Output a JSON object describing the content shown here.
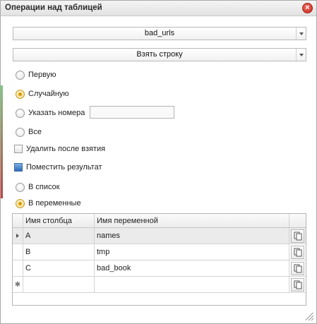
{
  "window": {
    "title": "Операции над таблицей"
  },
  "table_select": {
    "value": "bad_urls"
  },
  "operation_select": {
    "value": "Взять строку"
  },
  "row_options": [
    {
      "label": "Первую",
      "selected": false
    },
    {
      "label": "Случайную",
      "selected": true
    },
    {
      "label": "Указать номера",
      "selected": false,
      "input_value": ""
    },
    {
      "label": "Все",
      "selected": false
    }
  ],
  "delete_after": {
    "label": "Удалить после взятия",
    "checked": false
  },
  "put_result": {
    "label": "Поместить результат",
    "checked": true
  },
  "target_options": [
    {
      "label": "В список",
      "selected": false
    },
    {
      "label": "В переменные",
      "selected": true
    }
  ],
  "grid": {
    "columns": [
      "Имя столбца",
      "Имя переменной"
    ],
    "rows": [
      {
        "column": "A",
        "variable": "names",
        "selected": true
      },
      {
        "column": "B",
        "variable": "tmp",
        "selected": false
      },
      {
        "column": "C",
        "variable": "bad_book",
        "selected": false
      },
      {
        "column": "",
        "variable": "",
        "new_row": true
      }
    ]
  },
  "colors": {
    "accent_radio": "#d79a00",
    "close": "#c6281b",
    "checkbox_filled": "#2e69b3"
  }
}
